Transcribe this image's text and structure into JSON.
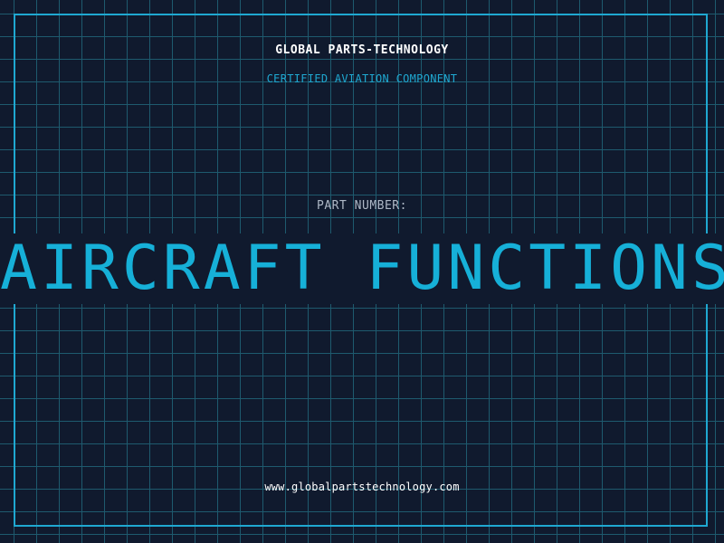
{
  "header": {
    "brand": "GLOBAL PARTS-TECHNOLOGY",
    "tagline": "CERTIFIED AVIATION COMPONENT"
  },
  "part": {
    "label": "PART NUMBER:",
    "title": "AIRCRAFT FUNCTIONS"
  },
  "footer": {
    "url": "www.globalpartstechnology.com"
  },
  "colors": {
    "background": "#101a2e",
    "grid": "#1e5a6e",
    "accent": "#1fa8d1",
    "title": "#16b0d8",
    "text": "#ffffff",
    "muted": "#aeb8c6"
  }
}
